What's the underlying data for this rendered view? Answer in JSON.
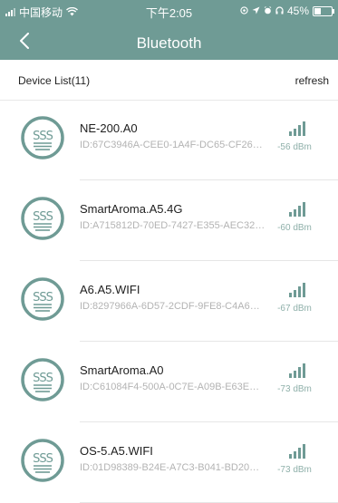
{
  "status_bar": {
    "carrier": "中国移动",
    "time": "下午2:05",
    "battery": "45%",
    "battery_level": 0.45
  },
  "header": {
    "back_icon": "chevron-left-icon",
    "title": "Bluetooth"
  },
  "toolbar": {
    "device_count_label": "Device List(11)",
    "refresh_label": "refresh"
  },
  "colors": {
    "accent": "#6f9b95",
    "rssi_text": "#8fb0aa",
    "id_text": "#b3b3b3"
  },
  "devices": [
    {
      "name": "NE-200.A0",
      "id": "ID:67C3946A-CEE0-1A4F-DC65-CF26…",
      "rssi": "-56 dBm",
      "icon": "aroma-diffuser-icon",
      "signal_icon": "signal-bars-icon"
    },
    {
      "name": "SmartAroma.A5.4G",
      "id": "ID:A715812D-70ED-7427-E355-AEC32…",
      "rssi": "-60 dBm",
      "icon": "aroma-diffuser-icon",
      "signal_icon": "signal-bars-icon"
    },
    {
      "name": "A6.A5.WIFI",
      "id": "ID:8297966A-6D57-2CDF-9FE8-C4A6…",
      "rssi": "-67 dBm",
      "icon": "aroma-diffuser-icon",
      "signal_icon": "signal-bars-icon"
    },
    {
      "name": "SmartAroma.A0",
      "id": "ID:C61084F4-500A-0C7E-A09B-E63E…",
      "rssi": "-73 dBm",
      "icon": "aroma-diffuser-icon",
      "signal_icon": "signal-bars-icon"
    },
    {
      "name": "OS-5.A5.WIFI",
      "id": "ID:01D98389-B24E-A7C3-B041-BD20…",
      "rssi": "-73 dBm",
      "icon": "aroma-diffuser-icon",
      "signal_icon": "signal-bars-icon"
    }
  ]
}
